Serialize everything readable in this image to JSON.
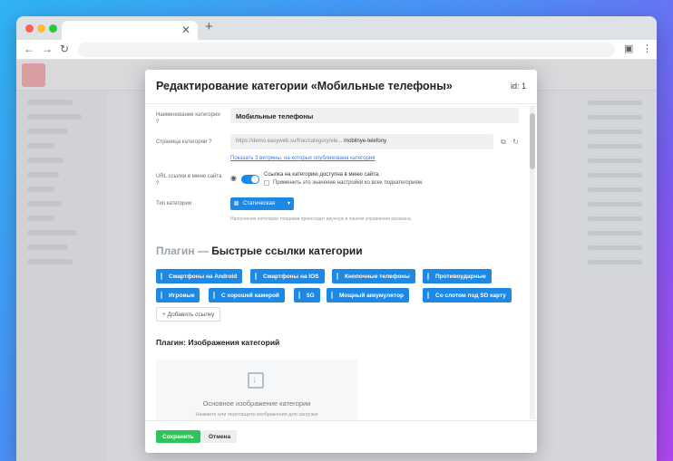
{
  "modal": {
    "title": "Редактирование категории «Мобильные телефоны»",
    "id_label": "id: 1"
  },
  "form": {
    "name_label": "Наименование категории",
    "name_value": "Мобильные телефоны",
    "page_label": "Страница категории",
    "url_prefix": "https://demo.easyweb.su/frac/category/ele...",
    "url_slug": "mobilnye-telefony",
    "showcase_link": "Показать 3 витрины, на которых опубликована категория",
    "menu_url_label": "URL ссылки в меню сайта",
    "menu_toggle_text": "Ссылка на категорию доступна в меню сайта.",
    "apply_subcategories": "Применить это значение настройки ко всех подкатегориям.",
    "type_label": "Тип категории",
    "type_value": "Статическая",
    "type_hint": "Наполнение категории товарами происходит вручную в панели управления магазина."
  },
  "plugin_links": {
    "title_prefix": "Плагин —",
    "title_main": "Быстрые ссылки категории",
    "chips": [
      "Смартфоны на Android",
      "Смартфоны на IOS",
      "Кнопочные телефоны",
      "Противоударные",
      "Игровые",
      "С хорошей камерой",
      "5G",
      "Мощный аккумулятор",
      "Со слотом под SD карту"
    ],
    "add_link": "+ Добавить ссылку"
  },
  "plugin_images": {
    "title": "Плагин: Изображения категорий",
    "drop_title": "Основное изображение категории",
    "drop_sub": "Нажмите или перетащите изображения для загрузки"
  },
  "footer": {
    "save": "Сохранить",
    "cancel": "Отмена"
  },
  "colors": {
    "accent": "#1e88e5",
    "save": "#2ec45a"
  }
}
